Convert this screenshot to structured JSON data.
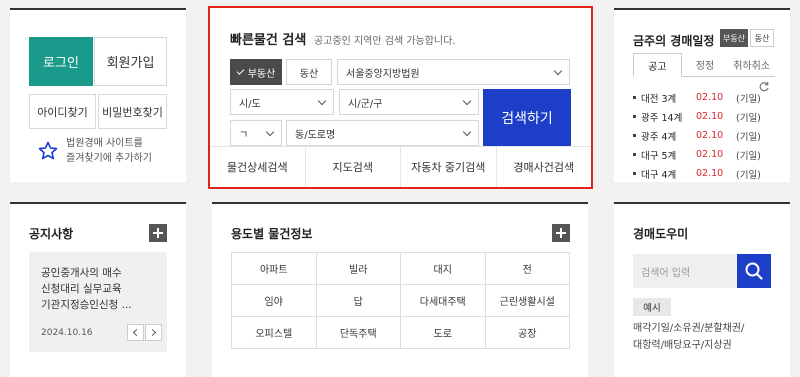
{
  "login": {
    "login_label": "로그인",
    "join_label": "회원가입",
    "find_id_label": "아이디찾기",
    "find_pw_label": "비밀번호찾기",
    "favorite_line1": "법원경매 사이트를",
    "favorite_line2": "즐겨찾기에 추가하기"
  },
  "quick_search": {
    "title": "빠른물건 검색",
    "subtitle": "공고중인 지역만 검색 가능합니다.",
    "type_realestate": "부동산",
    "type_movable": "동산",
    "court_value": "서울중앙지방법원",
    "sido_value": "시/도",
    "sigungu_value": "시/군/구",
    "initial_value": "ㄱ",
    "dong_value": "동/도로명",
    "search_label": "검색하기",
    "tabs": [
      "물건상세검색",
      "지도검색",
      "자동차 중기검색",
      "경매사건검색"
    ]
  },
  "schedule": {
    "title": "금주의 경매일정",
    "badge_realestate": "부동산",
    "badge_movable": "동산",
    "tabs": [
      "공고",
      "정정",
      "취하취소"
    ],
    "rows": [
      {
        "place": "대전 3계",
        "date": "02.10",
        "note": "(기일)"
      },
      {
        "place": "광주 14계",
        "date": "02.10",
        "note": "(기일)"
      },
      {
        "place": "광주 4계",
        "date": "02.10",
        "note": "(기일)"
      },
      {
        "place": "대구 5계",
        "date": "02.10",
        "note": "(기일)"
      },
      {
        "place": "대구 4계",
        "date": "02.10",
        "note": "(기일)"
      }
    ]
  },
  "notice": {
    "title": "공지사항",
    "line1": "공인중개사의 매수",
    "line2": "신청대리 실무교육",
    "line3": "기관지정승인신청 ...",
    "date": "2024.10.16"
  },
  "usage": {
    "title": "용도별 물건정보",
    "items": [
      "아파트",
      "빌라",
      "대지",
      "전",
      "임야",
      "답",
      "다세대주택",
      "근린생활시설",
      "오피스텔",
      "단독주택",
      "도로",
      "공장"
    ]
  },
  "helper": {
    "title": "경매도우미",
    "search_placeholder": "검색어 입력",
    "example_label": "예시",
    "tags_line1": "매각기일/소유권/분할채권/",
    "tags_line2": "대항력/배당요구/지상권"
  },
  "colors": {
    "accent_teal": "#1a9a8a",
    "accent_blue": "#1d3ec9",
    "highlight_red": "#e2231a",
    "date_red": "#d8262b"
  }
}
